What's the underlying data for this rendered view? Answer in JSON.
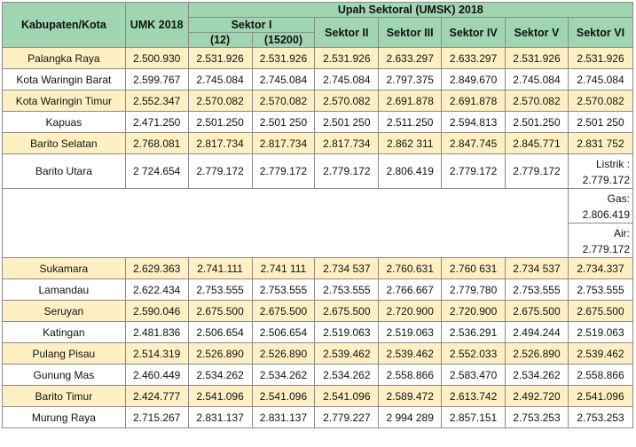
{
  "headers": {
    "kabupaten": "Kabupaten/Kota",
    "umk": "UMK 2018",
    "umsk": "Upah Sektoral (UMSK) 2018",
    "sektor1": "Sektor I",
    "sektor1_sub_a": "(12)",
    "sektor1_sub_b": "(15200)",
    "sektor2": "Sektor II",
    "sektor3": "Sektor III",
    "sektor4": "Sektor IV",
    "sektor5": "Sektor V",
    "sektor6": "Sektor VI"
  },
  "rows_top": [
    [
      "Palangka Raya",
      "2.500.930",
      "2.531.926",
      "2.531.926",
      "2.531.926",
      "2.633.297",
      "2.633.297",
      "2.531.926",
      "2.531.926"
    ],
    [
      "Kota Waringin Barat",
      "2.599.767",
      "2.745.084",
      "2.745.084",
      "2.745.084",
      "2.797.375",
      "2.849.670",
      "2.745.084",
      "2.745.084"
    ],
    [
      "Kota Waringin Timur",
      "2.552.347",
      "2.570.082",
      "2.570.082",
      "2.570.082",
      "2.691.878",
      "2.691.878",
      "2.570.082",
      "2.570.082"
    ],
    [
      "Kapuas",
      "2.471.250",
      "2.501.250",
      "2.501 250",
      "2.501 250",
      "2.511.250",
      "2.594.813",
      "2.501.250",
      "2.501 250"
    ],
    [
      "Barito Selatan",
      "2.768.081",
      "2.817.734",
      "2.817.734",
      "2.817.734",
      "2.862 311",
      "2.847.745",
      "2.845.771",
      "2.831 752"
    ]
  ],
  "barito_utara": {
    "name": "Barito Utara",
    "values": [
      "2 724.654",
      "2.779.172",
      "2.779.172",
      "2.779.172",
      "2.806.419",
      "2.779.172",
      "2.779.172"
    ],
    "listrik": [
      "Listrik :",
      "2.779.172"
    ],
    "gas": [
      "Gas:",
      "2.806.419"
    ],
    "air": [
      "Air:",
      "2.779.172"
    ]
  },
  "rows_bottom": [
    [
      "Sukamara",
      "2.629.363",
      "2.741.111",
      "2.741 111",
      "2.734 537",
      "2.760.631",
      "2.760 631",
      "2.734 537",
      "2.734.337"
    ],
    [
      "Lamandau",
      "2.622.434",
      "2.753.555",
      "2.753.555",
      "2.753.555",
      "2.766.667",
      "2.779.780",
      "2.753.555",
      "2.753.555"
    ],
    [
      "Seruyan",
      "2.590.046",
      "2.675.500",
      "2.675.500",
      "2.675.500",
      "2.720.900",
      "2.720.900",
      "2.675.500",
      "2.675.500"
    ],
    [
      "Katingan",
      "2.481.836",
      "2.506.654",
      "2.506.654",
      "2.519.063",
      "2.519.063",
      "2.536.291",
      "2.494.244",
      "2.519.063"
    ],
    [
      "Pulang Pisau",
      "2.514.319",
      "2.526.890",
      "2.526.890",
      "2.539.462",
      "2.539.462",
      "2.552.033",
      "2.526.890",
      "2.539.462"
    ],
    [
      "Gunung Mas",
      "2.460.449",
      "2.534.262",
      "2.534.262",
      "2.534.262",
      "2.558.866",
      "2.583.470",
      "2.534.262",
      "2.558.866"
    ],
    [
      "Barito Timur",
      "2.424.777",
      "2.541.096",
      "2.541.096",
      "2.541.096",
      "2.589.472",
      "2.613.742",
      "2.492.720",
      "2.541.096"
    ],
    [
      "Murung Raya",
      "2.715.267",
      "2.831.137",
      "2.831.137",
      "2.779.227",
      "2 994 289",
      "2.857.151",
      "2.753.253",
      "2.753.253"
    ]
  ]
}
